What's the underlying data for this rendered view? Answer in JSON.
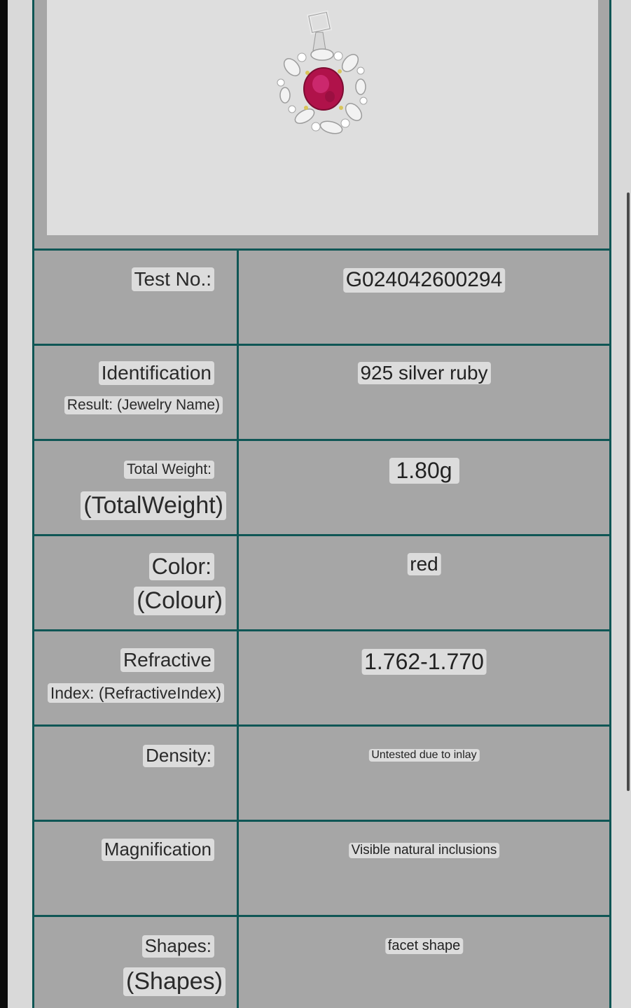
{
  "product_image": {
    "description_icon": "pendant-image",
    "stone_color": "#b0124a"
  },
  "rows": [
    {
      "label": "Test No.:",
      "sublabel": "",
      "value": "G024042600294"
    },
    {
      "label": "Identification",
      "sublabel": "Result: (Jewelry Name)",
      "value": "925 silver ruby"
    },
    {
      "label": "Total Weight:",
      "sublabel": "(TotalWeight)",
      "value": "1.80g"
    },
    {
      "label": "Color:",
      "sublabel": "(Colour)",
      "value": "red"
    },
    {
      "label": "Refractive",
      "sublabel": "Index: (RefractiveIndex)",
      "value": "1.762-1.770"
    },
    {
      "label": "Density:",
      "sublabel": "",
      "value": "Untested due to inlay"
    },
    {
      "label": "Magnification",
      "sublabel": "",
      "value": "Visible natural inclusions"
    },
    {
      "label": "Shapes:",
      "sublabel": "(Shapes)",
      "value": "facet shape"
    }
  ],
  "colors": {
    "border": "#0f5655",
    "cell_bg": "#a6a6a6",
    "text_bg": "#dcdcdc"
  }
}
